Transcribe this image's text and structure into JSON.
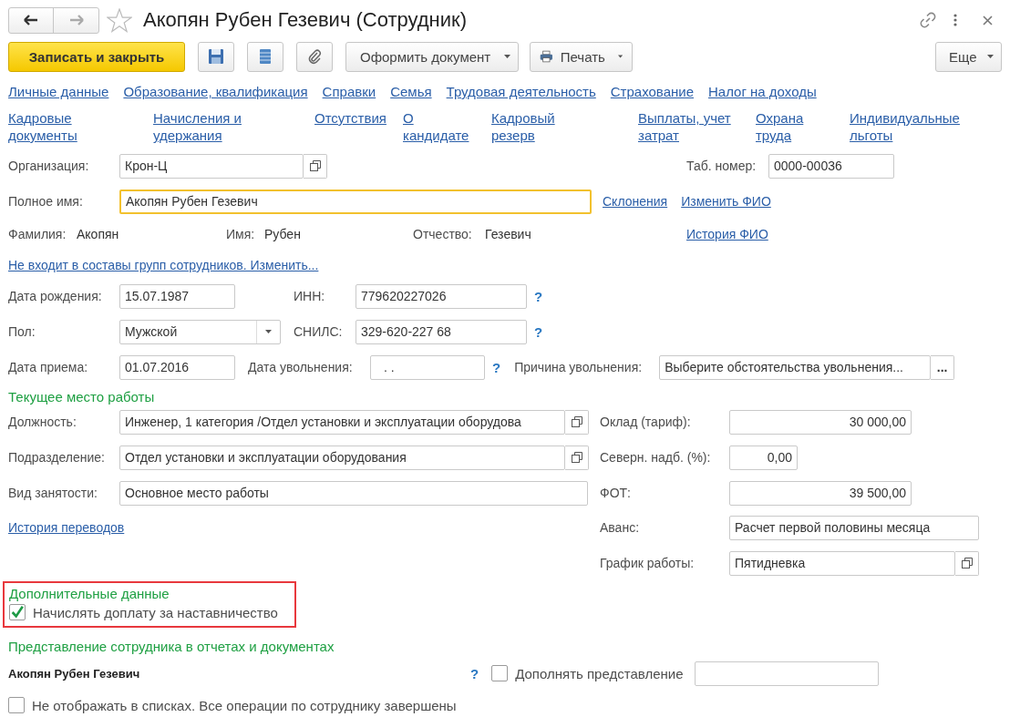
{
  "header": {
    "title": "Акопян Рубен Гезевич (Сотрудник)"
  },
  "toolbar": {
    "save_close": "Записать и закрыть",
    "create_document": "Оформить документ",
    "print": "Печать",
    "more": "Еще"
  },
  "section_links": [
    "Личные данные",
    "Образование, квалификация",
    "Справки",
    "Семья",
    "Трудовая деятельность",
    "Страхование",
    "Налог на доходы"
  ],
  "section_links_more": [
    "Кадровые\nдокументы",
    "Начисления и\nудержания",
    "Отсутствия",
    "О\nкандидате",
    "Кадровый\nрезерв",
    "Выплаты, учет\nзатрат",
    "Охрана\nтруда",
    "Индивидуальные\nльготы"
  ],
  "organization": {
    "label": "Организация:",
    "value": "Крон-Ц"
  },
  "tab_number": {
    "label": "Таб. номер:",
    "value": "0000-00036"
  },
  "full_name": {
    "label": "Полное имя:",
    "value": "Акопян Рубен Гезевич",
    "focused": true
  },
  "name_actions": [
    "Склонения",
    "Изменить ФИО"
  ],
  "name_parts": [
    {
      "label": "Фамилия:",
      "value": "Акопян"
    },
    {
      "label": "Имя:",
      "value": "Рубен"
    },
    {
      "label": "Отчество:",
      "value": "Гезевич"
    }
  ],
  "name_history": "История ФИО",
  "groups_link": "Не входит в составы групп сотрудников. Изменить...",
  "birth_date": {
    "label": "Дата рождения:",
    "value": "15.07.1987"
  },
  "inn": {
    "label": "ИНН:",
    "value": "779620227026",
    "help": "?"
  },
  "gender": {
    "label": "Пол:",
    "value": "Мужской"
  },
  "snils": {
    "label": "СНИЛС:",
    "value": "329-620-227 68",
    "help": "?"
  },
  "hire_date": {
    "label": "Дата приема:",
    "value": "01.07.2016"
  },
  "dismissal_date": {
    "label": "Дата увольнения:",
    "value": ".  .",
    "help": "?"
  },
  "dismissal_reason": {
    "label": "Причина увольнения:",
    "value": "Выберите обстоятельства увольнения...",
    "button": "..."
  },
  "current_job": {
    "title": "Текущее место работы",
    "position": {
      "label": "Должность:",
      "value": "Инженер, 1 категория /Отдел установки и эксплуатации оборудова"
    },
    "department": {
      "label": "Подразделение:",
      "value": "Отдел установки и эксплуатации оборудования"
    },
    "employment_type": {
      "label": "Вид занятости:",
      "value": "Основное место работы"
    },
    "transfers_link": "История переводов",
    "salary": {
      "label": "Оклад (тариф):",
      "value": "30 000,00"
    },
    "north_bonus": {
      "label": "Северн. надб. (%):",
      "value": "0,00"
    },
    "payroll": {
      "label": "ФОТ:",
      "value": "39 500,00"
    },
    "advance": {
      "label": "Аванс:",
      "value": "Расчет первой половины месяца"
    },
    "schedule": {
      "label": "График работы:",
      "value": "Пятидневка"
    }
  },
  "additional": {
    "title": "Дополнительные данные",
    "highlighted": true,
    "options": [
      {
        "label": "Начислять доплату за наставничество",
        "checked": true
      }
    ]
  },
  "presentation": {
    "title": "Представление сотрудника в отчетах и документах",
    "name": "Акопян Рубен Гезевич",
    "help": "?",
    "supplement": {
      "label": "Дополнять представление",
      "checked": false
    }
  },
  "hide_in_lists": {
    "label": "Не отображать в списках. Все операции по сотруднику завершены",
    "checked": false
  }
}
